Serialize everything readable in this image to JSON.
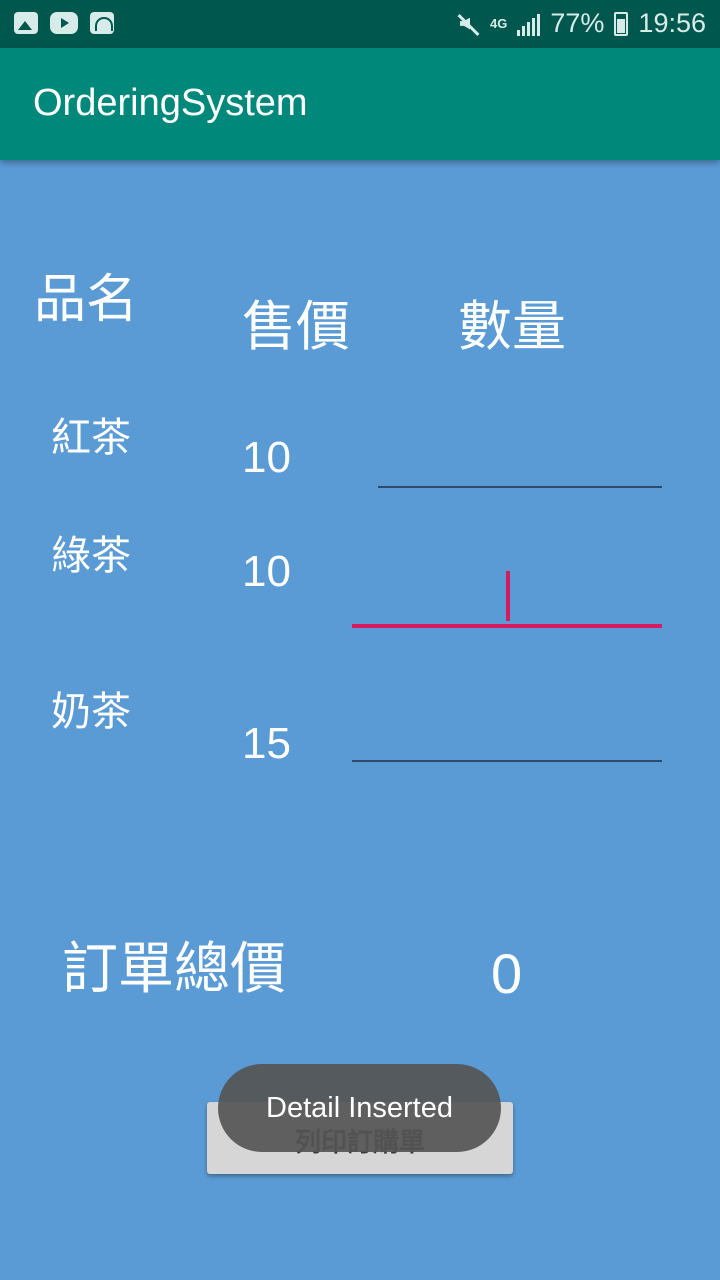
{
  "status_bar": {
    "icons_left": [
      "image-icon",
      "youtube-icon",
      "wifi-box-icon"
    ],
    "network": "4G",
    "battery": "77%",
    "time": "19:56"
  },
  "app_bar": {
    "title": "OrderingSystem"
  },
  "table": {
    "headers": {
      "name": "品名",
      "price": "售價",
      "quantity": "數量"
    },
    "items": [
      {
        "name": "紅茶",
        "price": "10",
        "quantity": ""
      },
      {
        "name": "綠茶",
        "price": "10",
        "quantity": ""
      },
      {
        "name": "奶茶",
        "price": "15",
        "quantity": ""
      }
    ]
  },
  "total": {
    "label": "訂單總價",
    "value": "0"
  },
  "print_button": {
    "label": "列印訂購單"
  },
  "toast": {
    "message": "Detail Inserted"
  },
  "colors": {
    "background": "#5b9bd5",
    "app_bar": "#00897b",
    "status_bar": "#00574e",
    "accent": "#d81b60"
  }
}
